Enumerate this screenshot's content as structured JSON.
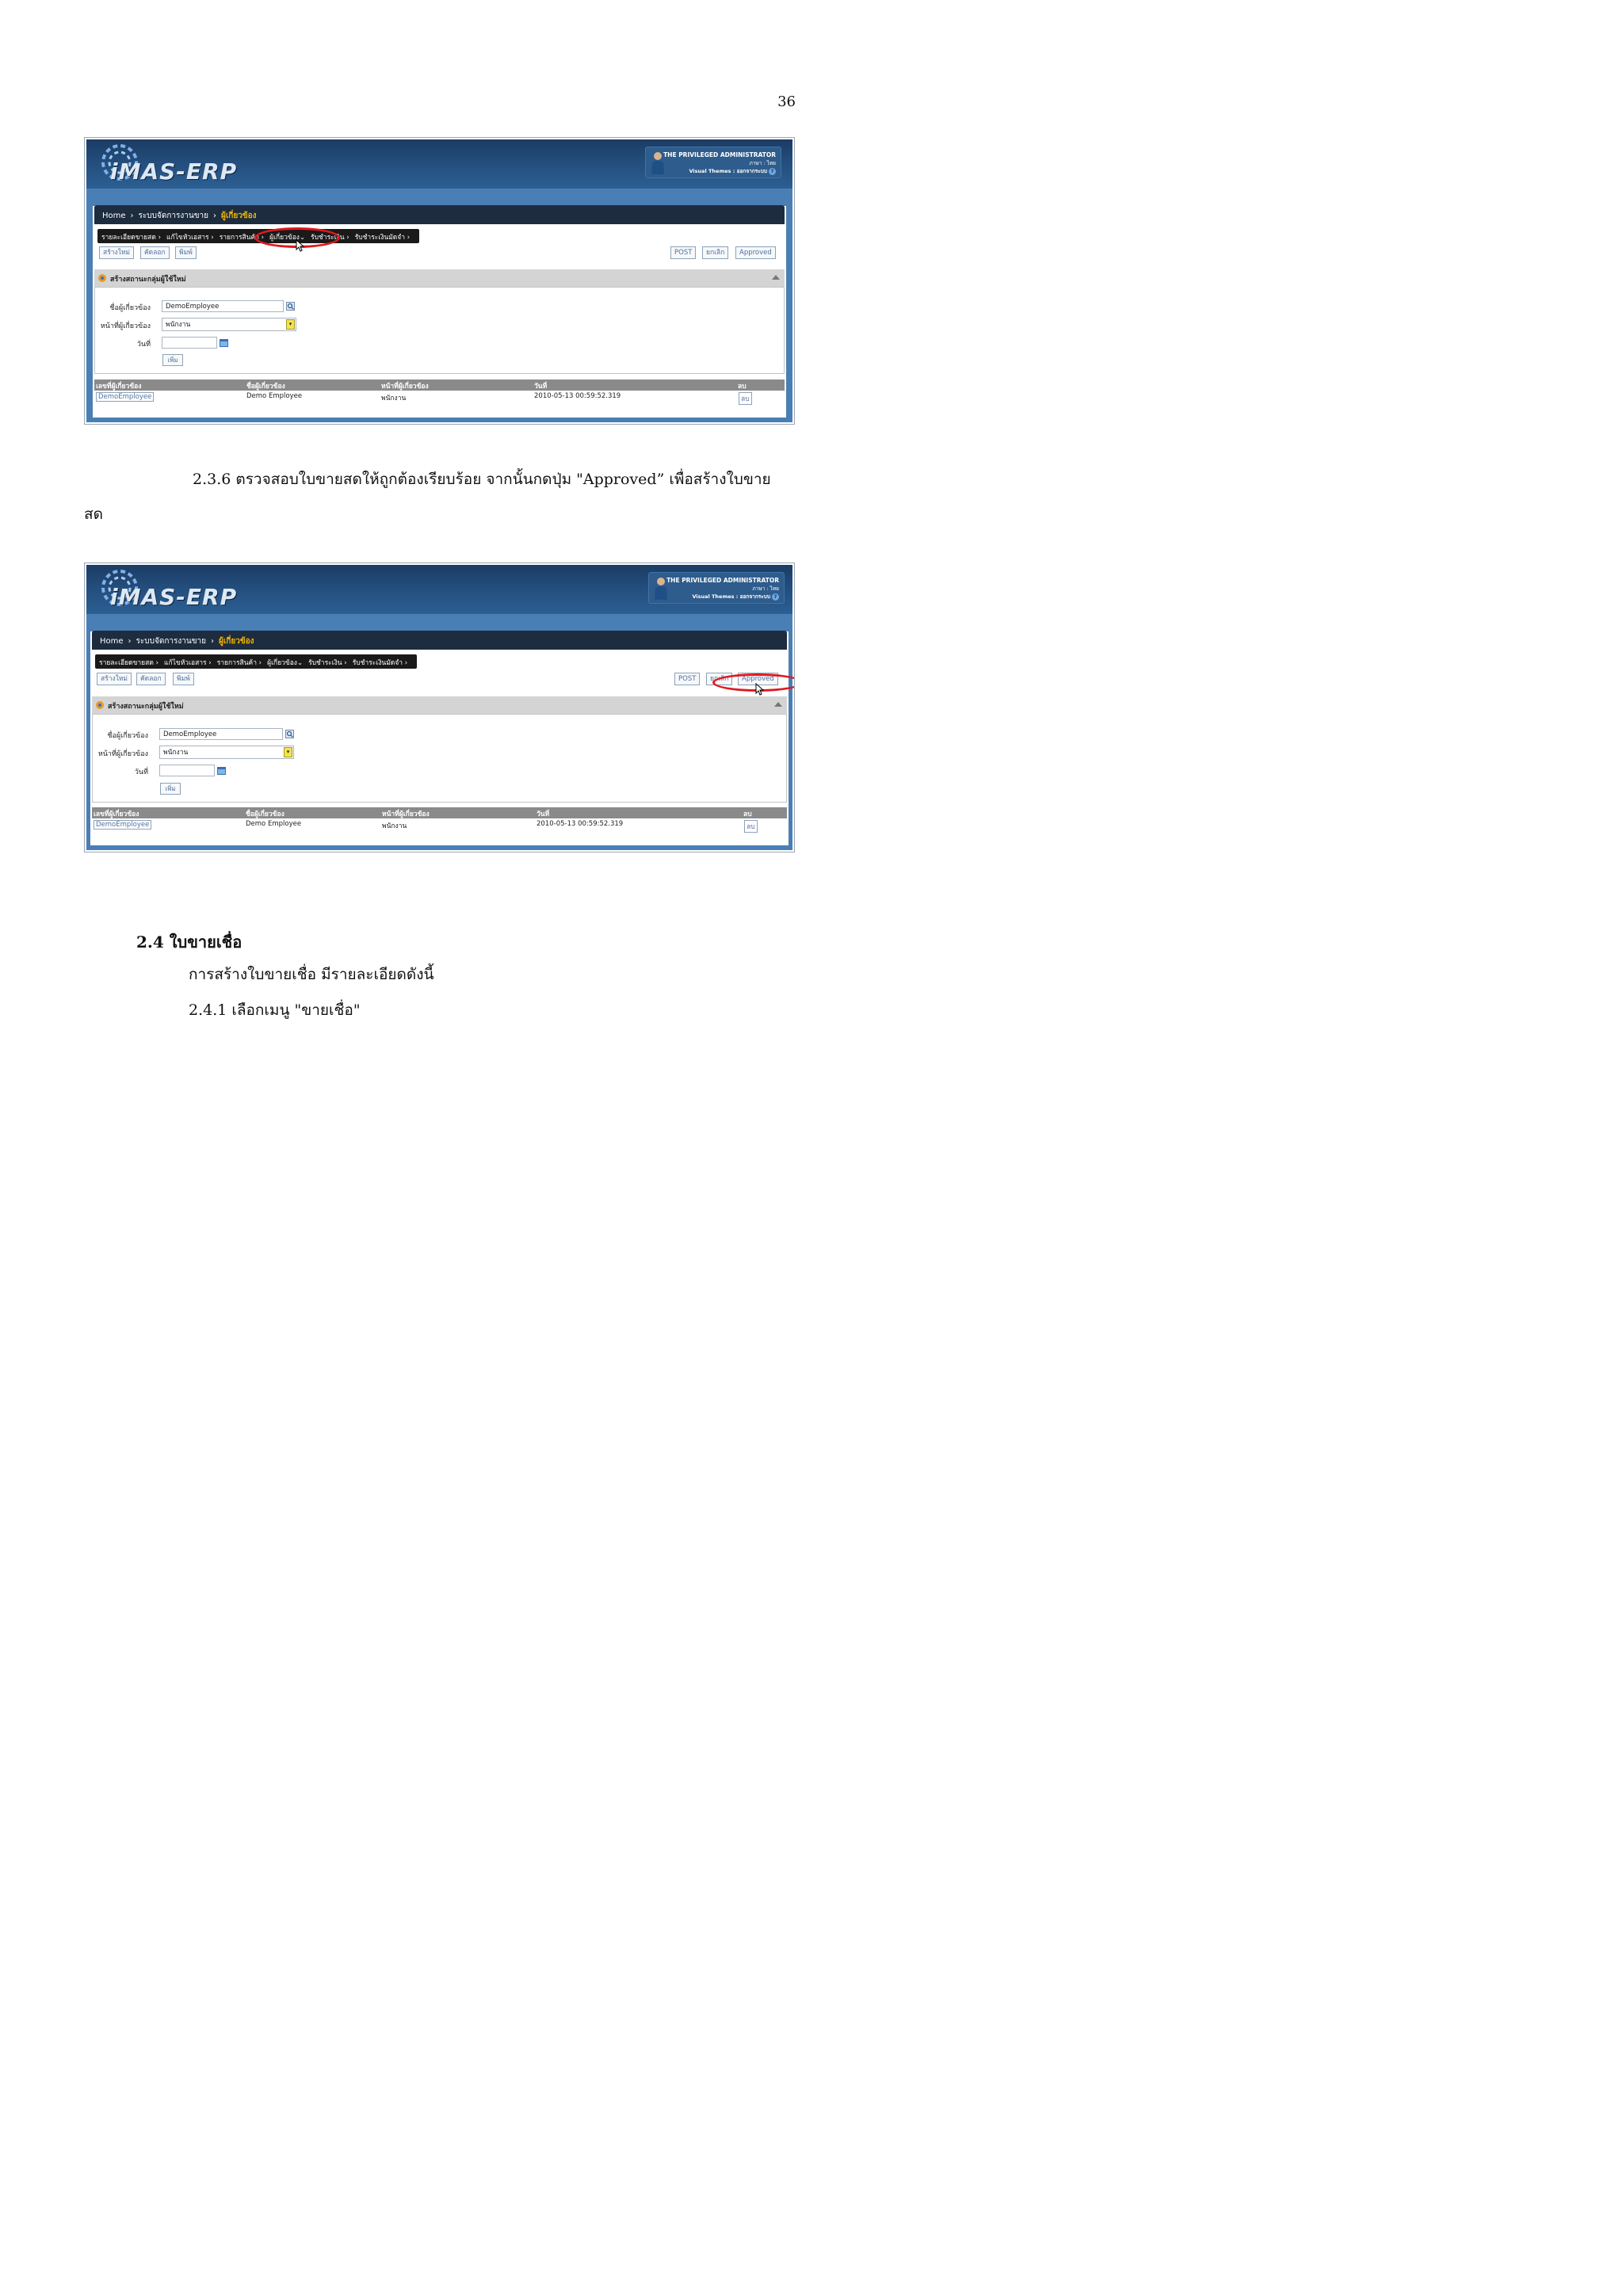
{
  "page_number": "36",
  "app": {
    "logo": "iMAS-ERP",
    "user_name": "THE PRIVILEGED ADMINISTRATOR",
    "language": "ภาษา : ไทย",
    "visual_themes": "Visual Themes : ออกจากระบบ",
    "help": "?"
  },
  "breadcrumb": {
    "home": "Home",
    "section": "ระบบจัดการงานขาย",
    "current": "ผู้เกี่ยวข้อง",
    "sep": "›"
  },
  "submenu": [
    "รายละเอียดขายสด ›",
    "แก้ไขหัวเอสาร ›",
    "รายการสินค้า ›",
    "ผู้เกี่ยวข้อง⌄",
    "รับชำระเงิน ›",
    "รับชำระเงินมัดจำ ›"
  ],
  "toolbar": {
    "create": "สร้างใหม่",
    "copy": "คัดลอก",
    "print": "พิมพ์",
    "post": "POST",
    "cancel": "ยกเลิก",
    "approved": "Approved"
  },
  "panel": {
    "title": "สร้างสถานะกลุ่มผู้ใช้ใหม่"
  },
  "form": {
    "related_label": "ชื่อผู้เกี่ยวข้อง",
    "related_value": "DemoEmployee",
    "role_label": "หน้าที่ผู้เกี่ยวข้อง",
    "role_value": "พนักงาน",
    "date_label": "วันที่",
    "date_value": "",
    "add_button": "เพิ่ม"
  },
  "table": {
    "headers": [
      "เลขที่ผู้เกี่ยวข้อง",
      "ชื่อผู้เกี่ยวข้อง",
      "หน้าที่ผู้เกี่ยวข้อง",
      "วันที่",
      "ลบ"
    ],
    "rows": [
      [
        "DemoEmployee",
        "Demo Employee",
        "พนักงาน",
        "2010-05-13 00:59:52.319",
        "ลบ"
      ]
    ]
  },
  "text": {
    "step_236": "2.3.6 ตรวจสอบใบขายสดให้ถูกต้องเรียบร้อย จากนั้นกดปุ่ม \"Approved” เพื่อสร้างใบขาย",
    "step_236_cont": "สด",
    "heading_24": "2.4 ใบขายเชื่อ",
    "intro_24": "การสร้างใบขายเชื่อ มีรายละเอียดดังนี้",
    "step_241": "2.4.1 เลือกเมนู \"ขายเชื่อ\""
  },
  "colors": {
    "banner": "#1b3c64",
    "frame": "#4a7fb5",
    "highlight": "#e0191f",
    "breadcrumb_current": "#f4b400"
  }
}
